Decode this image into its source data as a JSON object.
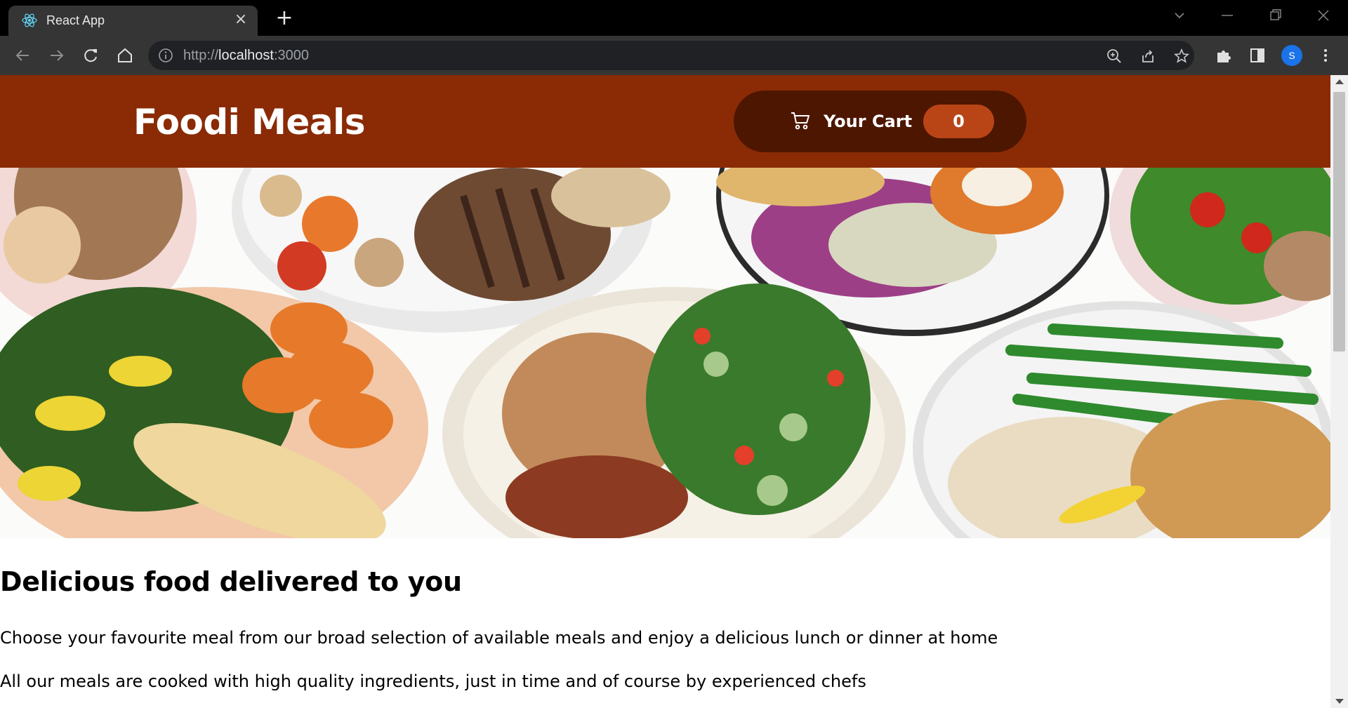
{
  "browser": {
    "tab": {
      "title": "React App",
      "favicon": "react-logo-icon"
    },
    "address": {
      "scheme": "http://",
      "host": "localhost",
      "port": ":3000"
    },
    "profile_initial": "S",
    "colors": {
      "tabstrip": "#000000",
      "toolbar": "#353535",
      "omnibox": "#202124",
      "profile": "#1a73e8"
    }
  },
  "app": {
    "title": "Foodi Meals",
    "cart": {
      "label": "Your Cart",
      "count": "0",
      "icon": "cart-icon"
    },
    "colors": {
      "header": "#8a2b06",
      "cart_button": "#4d1601",
      "badge": "#b94517"
    }
  },
  "hero": {
    "icon": "meals-photo"
  },
  "summary": {
    "title": "Delicious food delivered to you",
    "paragraph1": "Choose your favourite meal from our broad selection of available meals and enjoy a delicious lunch or dinner at home",
    "paragraph2": "All our meals are cooked with high quality ingredients, just in time and of course by experienced chefs"
  }
}
